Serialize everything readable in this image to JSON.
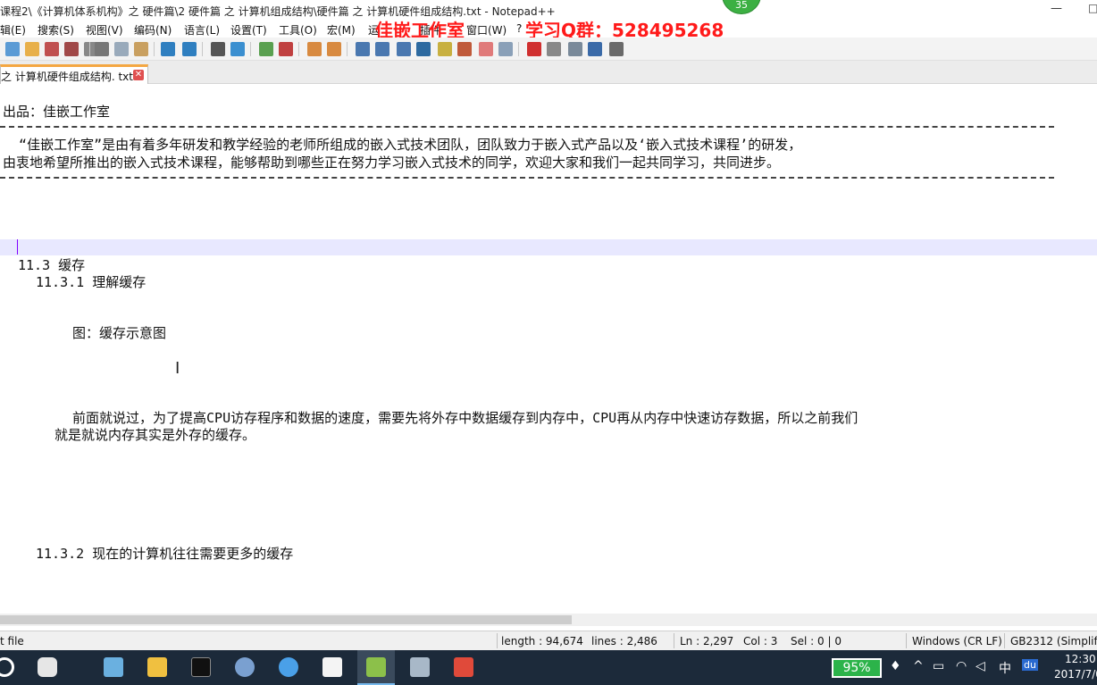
{
  "window": {
    "title": "课程2\\《计算机体系机构》之 硬件篇\\2 硬件篇 之 计算机组成结构\\硬件篇 之 计算机硬件组成结构.txt - Notepad++",
    "badge": "35",
    "minimize": "—",
    "maximize": "□"
  },
  "overlay": {
    "studio": "佳嵌工作室",
    "qq_group": "学习Q群：528495268"
  },
  "menu": {
    "items": [
      "辑(E)",
      "搜索(S)",
      "视图(V)",
      "编码(N)",
      "语言(L)",
      "设置(T)",
      "工具(O)",
      "宏(M)",
      "运",
      "插件",
      "窗口(W)",
      "?"
    ]
  },
  "toolbar": {
    "icons": [
      "new-icon",
      "open-icon",
      "save-icon",
      "save-all-icon",
      "close-icon",
      "print-icon",
      "cut-icon",
      "copy-icon",
      "paste-icon",
      "undo-icon",
      "redo-icon",
      "find-icon",
      "replace-icon",
      "zoom-in-icon",
      "zoom-out-icon",
      "sync-v-icon",
      "sync-h-icon",
      "word-wrap-icon",
      "all-chars-icon",
      "indent-guide-icon",
      "udl-icon",
      "doc-map-icon",
      "function-list-icon",
      "folder-workspace-icon",
      "monitor-icon",
      "record-macro-icon",
      "stop-macro-icon",
      "play-macro-icon",
      "run-macro-multiple-icon",
      "save-macro-icon"
    ]
  },
  "tab": {
    "label": "之 计算机硬件组成结构. txt",
    "close": "✕"
  },
  "editor": {
    "lines": {
      "l1": "出品：佳嵌工作室",
      "l2": "  “佳嵌工作室”是由有着多年研发和教学经验的老师所组成的嵌入式技术团队，团队致力于嵌入式产品以及‘嵌入式技术课程’的研发，",
      "l3": "由衷地希望所推出的嵌入式技术课程，能够帮助到哪些正在努力学习嵌入式技术的同学，欢迎大家和我们一起共同学习，共同进步。",
      "l4": "11.3 缓存",
      "l5": "11.3.1 理解缓存",
      "l6": "图：缓存示意图",
      "l7": "前面就说过，为了提高CPU访存程序和数据的速度，需要先将外存中数据缓存到内存中，CPU再从内存中快速访存数据，所以之前我们",
      "l8": "就是就说内存其实是外存的缓存。",
      "l9": "11.3.2 现在的计算机往往需要更多的缓存"
    }
  },
  "status": {
    "file_type": "t file",
    "length": "length : 94,674",
    "lines": "lines : 2,486",
    "ln": "Ln : 2,297",
    "col": "Col : 3",
    "sel": "Sel : 0 | 0",
    "eol": "Windows (CR LF)",
    "encoding": "GB2312 (Simplifie"
  },
  "taskbar": {
    "battery": "95%",
    "ime": "中",
    "time": "12:30",
    "date": "2017/7/0"
  },
  "colors": {
    "overlay_red": "#ff1a1a",
    "current_line": "#e8e8ff",
    "caret": "#8000ff",
    "tab_accent": "#f4a742",
    "taskbar_bg": "#1c2a3a",
    "battery_green": "#2cb34a"
  }
}
